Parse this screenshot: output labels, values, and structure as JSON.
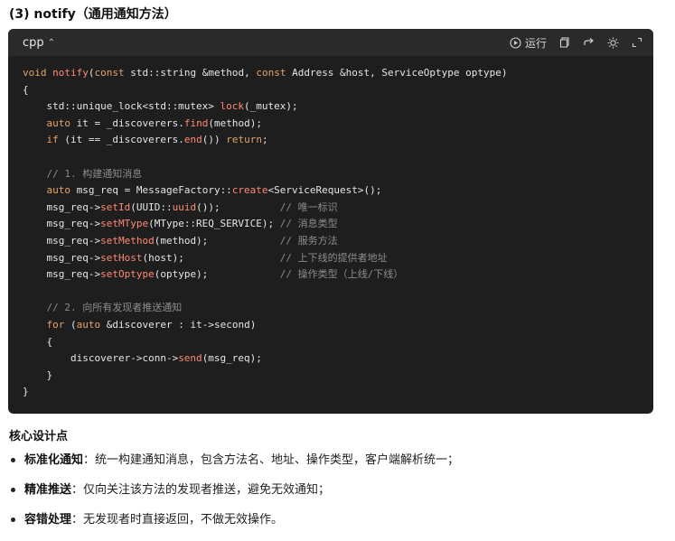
{
  "heading": "(3) notify（通用通知方法）",
  "code": {
    "language": "cpp",
    "toolbar": {
      "run_label": "运行",
      "icons": [
        "run-icon",
        "copy-icon",
        "share-icon",
        "theme-icon",
        "expand-icon"
      ]
    },
    "lines": [
      [
        {
          "t": "void",
          "c": "kw"
        },
        {
          "t": " "
        },
        {
          "t": "notify",
          "c": "fn"
        },
        {
          "t": "("
        },
        {
          "t": "const",
          "c": "kw"
        },
        {
          "t": " std::string &method, "
        },
        {
          "t": "const",
          "c": "kw"
        },
        {
          "t": " Address &host, ServiceOptype optype)"
        }
      ],
      [
        {
          "t": "{"
        }
      ],
      [
        {
          "t": "    std::unique_lock<std::mutex> "
        },
        {
          "t": "lock",
          "c": "fn"
        },
        {
          "t": "(_mutex);"
        }
      ],
      [
        {
          "t": "    "
        },
        {
          "t": "auto",
          "c": "kw"
        },
        {
          "t": " it = _discoverers."
        },
        {
          "t": "find",
          "c": "fn"
        },
        {
          "t": "(method);"
        }
      ],
      [
        {
          "t": "    "
        },
        {
          "t": "if",
          "c": "kw"
        },
        {
          "t": " (it == _discoverers."
        },
        {
          "t": "end",
          "c": "fn"
        },
        {
          "t": "()) "
        },
        {
          "t": "return",
          "c": "kw"
        },
        {
          "t": ";"
        }
      ],
      [
        {
          "t": ""
        }
      ],
      [
        {
          "t": "    // 1. 构建通知消息",
          "c": "cm"
        }
      ],
      [
        {
          "t": "    "
        },
        {
          "t": "auto",
          "c": "kw"
        },
        {
          "t": " msg_req = MessageFactory::"
        },
        {
          "t": "create",
          "c": "fn"
        },
        {
          "t": "<ServiceRequest>();"
        }
      ],
      [
        {
          "t": "    msg_req->"
        },
        {
          "t": "setId",
          "c": "fn"
        },
        {
          "t": "(UUID::"
        },
        {
          "t": "uuid",
          "c": "fn"
        },
        {
          "t": "());          "
        },
        {
          "t": "// 唯一标识",
          "c": "cm"
        }
      ],
      [
        {
          "t": "    msg_req->"
        },
        {
          "t": "setMType",
          "c": "fn"
        },
        {
          "t": "(MType::REQ_SERVICE); "
        },
        {
          "t": "// 消息类型",
          "c": "cm"
        }
      ],
      [
        {
          "t": "    msg_req->"
        },
        {
          "t": "setMethod",
          "c": "fn"
        },
        {
          "t": "(method);            "
        },
        {
          "t": "// 服务方法",
          "c": "cm"
        }
      ],
      [
        {
          "t": "    msg_req->"
        },
        {
          "t": "setHost",
          "c": "fn"
        },
        {
          "t": "(host);                "
        },
        {
          "t": "// 上下线的提供者地址",
          "c": "cm"
        }
      ],
      [
        {
          "t": "    msg_req->"
        },
        {
          "t": "setOptype",
          "c": "fn"
        },
        {
          "t": "(optype);            "
        },
        {
          "t": "// 操作类型（上线/下线）",
          "c": "cm"
        }
      ],
      [
        {
          "t": ""
        }
      ],
      [
        {
          "t": "    // 2. 向所有发现者推送通知",
          "c": "cm"
        }
      ],
      [
        {
          "t": "    "
        },
        {
          "t": "for",
          "c": "kw"
        },
        {
          "t": " ("
        },
        {
          "t": "auto",
          "c": "kw"
        },
        {
          "t": " &discoverer : it->second)"
        }
      ],
      [
        {
          "t": "    {"
        }
      ],
      [
        {
          "t": "        discoverer->conn->"
        },
        {
          "t": "send",
          "c": "fn"
        },
        {
          "t": "(msg_req);"
        }
      ],
      [
        {
          "t": "    }"
        }
      ],
      [
        {
          "t": "}"
        }
      ]
    ]
  },
  "design": {
    "title": "核心设计点",
    "points": [
      {
        "label": "标准化通知",
        "text": "：统一构建通知消息，包含方法名、地址、操作类型，客户端解析统一；"
      },
      {
        "label": "精准推送",
        "text": "：仅向关注该方法的发现者推送，避免无效通知；"
      },
      {
        "label": "容错处理",
        "text": "：无发现者时直接返回，不做无效操作。"
      }
    ]
  },
  "colors": {
    "code_bg": "#1e1e1e",
    "keyword": "#e5a36b",
    "function": "#ff8a73",
    "comment": "#8c8c8c"
  }
}
